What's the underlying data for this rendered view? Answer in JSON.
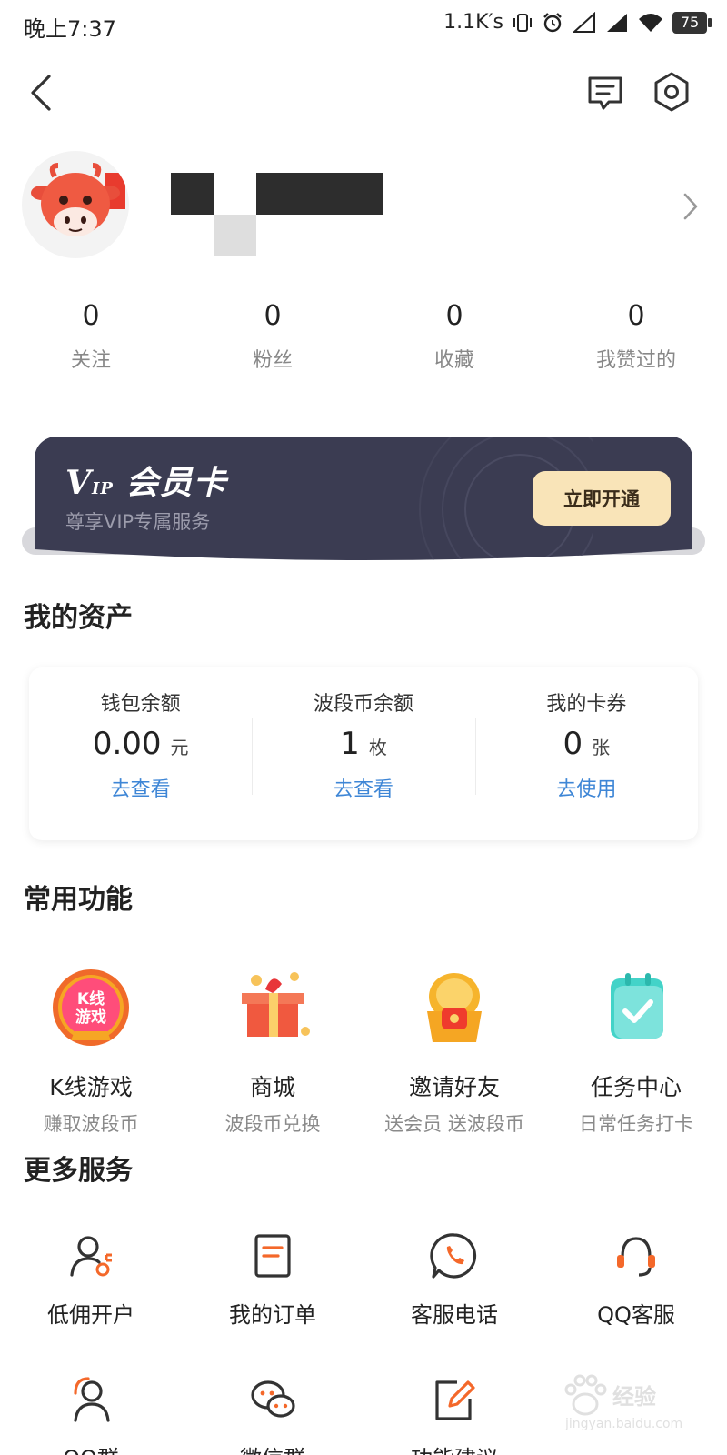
{
  "status_bar": {
    "time": "晚上7:37",
    "speed": "1.1K′s",
    "battery": "75"
  },
  "stats": [
    {
      "value": "0",
      "label": "关注"
    },
    {
      "value": "0",
      "label": "粉丝"
    },
    {
      "value": "0",
      "label": "收藏"
    },
    {
      "value": "0",
      "label": "我赞过的"
    }
  ],
  "vip": {
    "logo_v": "V",
    "logo_ip": "IP",
    "title": "会员卡",
    "subtitle": "尊享VIP专属服务",
    "button": "立即开通"
  },
  "assets": {
    "title": "我的资产",
    "items": [
      {
        "label": "钱包余额",
        "value": "0.00",
        "unit": "元",
        "link": "去查看"
      },
      {
        "label": "波段币余额",
        "value": "1",
        "unit": "枚",
        "link": "去查看"
      },
      {
        "label": "我的卡券",
        "value": "0",
        "unit": "张",
        "link": "去使用"
      }
    ]
  },
  "functions": {
    "title": "常用功能",
    "items": [
      {
        "name": "K线游戏",
        "sub": "赚取波段币",
        "icon": "k-line-game-icon",
        "badge_line1": "K线",
        "badge_line2": "游戏"
      },
      {
        "name": "商城",
        "sub": "波段币兑换",
        "icon": "mall-icon"
      },
      {
        "name": "邀请好友",
        "sub": "送会员 送波段币",
        "icon": "invite-friends-icon"
      },
      {
        "name": "任务中心",
        "sub": "日常任务打卡",
        "icon": "task-center-icon"
      }
    ]
  },
  "services": {
    "title": "更多服务",
    "items": [
      {
        "name": "低佣开户",
        "icon": "user-account-icon"
      },
      {
        "name": "我的订单",
        "icon": "order-icon"
      },
      {
        "name": "客服电话",
        "icon": "phone-icon"
      },
      {
        "name": "QQ客服",
        "icon": "headset-icon"
      },
      {
        "name": "QQ群",
        "icon": "qq-group-icon"
      },
      {
        "name": "微信群",
        "icon": "wechat-group-icon"
      },
      {
        "name": "功能建议",
        "icon": "edit-icon"
      }
    ]
  },
  "watermark": {
    "text": "经验",
    "url": "jingyan.baidu.com"
  },
  "colors": {
    "accent_orange": "#f4682a",
    "link_blue": "#3e86d6",
    "vip_dark": "#3b3c52",
    "vip_button": "#f9e4b8"
  }
}
